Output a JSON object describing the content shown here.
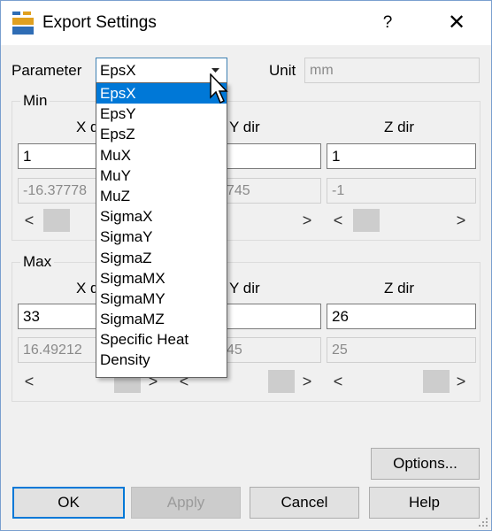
{
  "window": {
    "title": "Export Settings",
    "help_label": "?",
    "close_label": "✕"
  },
  "parameter": {
    "label": "Parameter",
    "selected": "EpsX",
    "options": [
      "EpsX",
      "EpsY",
      "EpsZ",
      "MuX",
      "MuY",
      "MuZ",
      "SigmaX",
      "SigmaY",
      "SigmaZ",
      "SigmaMX",
      "SigmaMY",
      "SigmaMZ",
      "Specific Heat",
      "Density"
    ],
    "unit_label": "Unit",
    "unit_value": "mm"
  },
  "min": {
    "title": "Min",
    "x_label": "X dir",
    "y_label": "Y dir",
    "z_label": "Z dir",
    "x_value": "1",
    "y_value": "",
    "z_value": "1",
    "x_readout": "-16.37778",
    "y_readout": "745",
    "z_readout": "-1"
  },
  "max": {
    "title": "Max",
    "x_label": "X dir",
    "y_label": "Y dir",
    "z_label": "Z dir",
    "x_value": "33",
    "y_value": "",
    "z_value": "26",
    "x_readout": "16.49212",
    "y_readout": "45",
    "z_readout": "25"
  },
  "scroll": {
    "left": "<",
    "right": ">"
  },
  "buttons": {
    "options": "Options...",
    "ok": "OK",
    "apply": "Apply",
    "cancel": "Cancel",
    "help": "Help"
  },
  "colors": {
    "selection": "#0078d7",
    "default_button_border": "#0078d7"
  }
}
